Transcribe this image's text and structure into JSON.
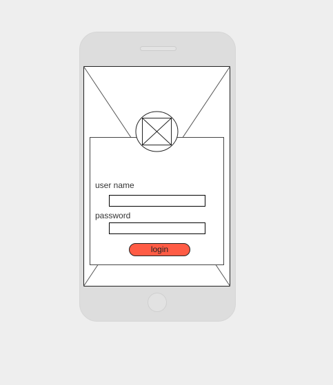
{
  "form": {
    "username_label": "user name",
    "password_label": "password",
    "username_value": "",
    "password_value": "",
    "login_label": "login"
  },
  "colors": {
    "background": "#eeeeee",
    "phone_body": "#dddddd",
    "login_button": "#ff5c45"
  },
  "icons": {
    "avatar": "image-placeholder-icon",
    "background": "image-placeholder"
  }
}
